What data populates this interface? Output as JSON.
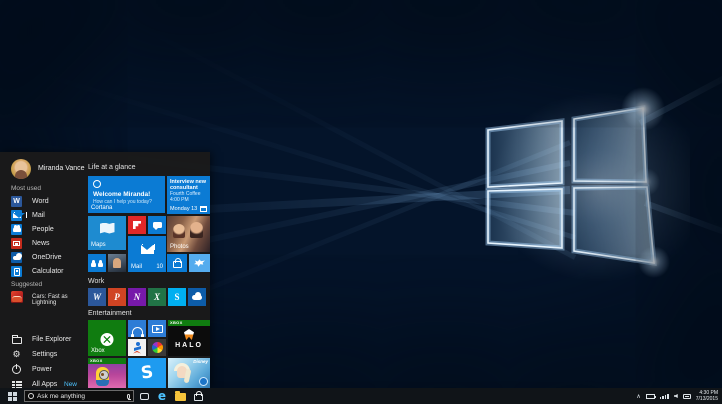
{
  "start_menu": {
    "user": {
      "name": "Miranda Vance"
    },
    "most_used_header": "Most used",
    "most_used_items": [
      {
        "label": "Word",
        "icon": "word-icon"
      },
      {
        "label": "Mail",
        "icon": "mail-icon"
      },
      {
        "label": "People",
        "icon": "people-icon"
      },
      {
        "label": "News",
        "icon": "news-icon"
      },
      {
        "label": "OneDrive",
        "icon": "onedrive-icon"
      },
      {
        "label": "Calculator",
        "icon": "calculator-icon"
      }
    ],
    "suggested_header": "Suggested",
    "suggested_items": [
      {
        "label": "Cars: Fast as Lightning",
        "icon": "cars-game-icon"
      }
    ],
    "footer_items": [
      {
        "label": "File Explorer",
        "icon": "folder-icon"
      },
      {
        "label": "Settings",
        "icon": "gear-icon"
      },
      {
        "label": "Power",
        "icon": "power-icon"
      },
      {
        "label": "All Apps",
        "icon": "all-apps-icon",
        "badge": "New"
      }
    ],
    "group_headers": [
      "Life at a glance",
      "Work",
      "Entertainment"
    ],
    "tiles": {
      "cortana": {
        "greeting": "Welcome Miranda!",
        "prompt": "How can I help you today?",
        "label": "Cortana"
      },
      "calendar": {
        "event_title": "Interview new consultant",
        "event_location": "Fourth Coffee",
        "event_time": "4:00 PM",
        "date": "Monday 13"
      },
      "maps": {
        "label": "Maps"
      },
      "mail": {
        "label": "Mail",
        "unread_count": "10"
      },
      "photos": {
        "label": "Photos"
      },
      "xbox": {
        "label": "Xbox"
      },
      "halo": {
        "platform_header": "XBOX",
        "title": "HALO"
      },
      "minions": {
        "platform_header": "XBOX"
      },
      "frozen": {
        "brand": "Disney"
      }
    }
  },
  "taskbar": {
    "search_placeholder": "Ask me anything",
    "clock": {
      "time": "4:30 PM",
      "date": "7/13/2015"
    }
  },
  "colors": {
    "accent_blue": "#0b7bd4",
    "menu_background": "#1a1a1a",
    "taskbar_background": "#101418",
    "new_badge_blue": "#4cc2ff",
    "word_blue": "#2b579a",
    "powerpoint_orange": "#d04423",
    "onenote_purple": "#7719aa",
    "excel_green": "#217346",
    "skype_blue": "#00aff0",
    "onedrive_blue": "#0d5ca8",
    "flipboard_red": "#e12828",
    "xbox_green": "#107c10",
    "twitter_blue": "#55acee",
    "news_red": "#c42b1c",
    "shazam_blue": "#1e9bf0"
  }
}
